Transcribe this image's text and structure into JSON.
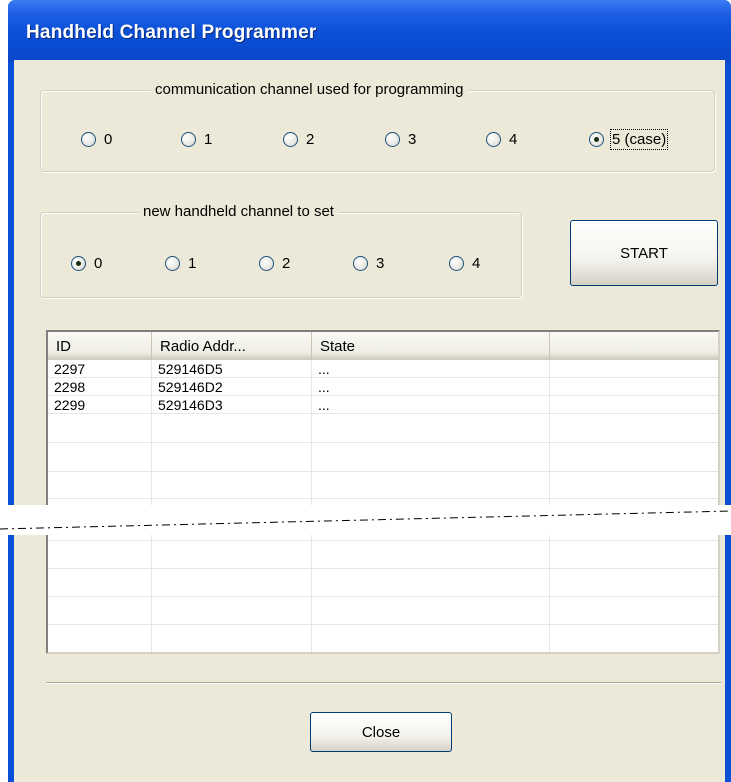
{
  "window": {
    "title": "Handheld Channel Programmer"
  },
  "comm_group": {
    "legend": "communication channel used for programming",
    "options": [
      {
        "label": "0",
        "checked": false
      },
      {
        "label": "1",
        "checked": false
      },
      {
        "label": "2",
        "checked": false
      },
      {
        "label": "3",
        "checked": false
      },
      {
        "label": "4",
        "checked": false
      },
      {
        "label": "5 (case)",
        "checked": true
      }
    ]
  },
  "new_group": {
    "legend": "new handheld channel to set",
    "options": [
      {
        "label": "0",
        "checked": true
      },
      {
        "label": "1",
        "checked": false
      },
      {
        "label": "2",
        "checked": false
      },
      {
        "label": "3",
        "checked": false
      },
      {
        "label": "4",
        "checked": false
      }
    ]
  },
  "start_button": {
    "label": "START"
  },
  "table": {
    "columns": [
      "ID",
      "Radio Addr...",
      "State",
      ""
    ],
    "rows": [
      [
        "2297",
        "529146D5",
        "...",
        ""
      ],
      [
        "2298",
        "529146D2",
        "...",
        ""
      ],
      [
        "2299",
        "529146D3",
        "...",
        ""
      ]
    ]
  },
  "close_button": {
    "label": "Close"
  }
}
